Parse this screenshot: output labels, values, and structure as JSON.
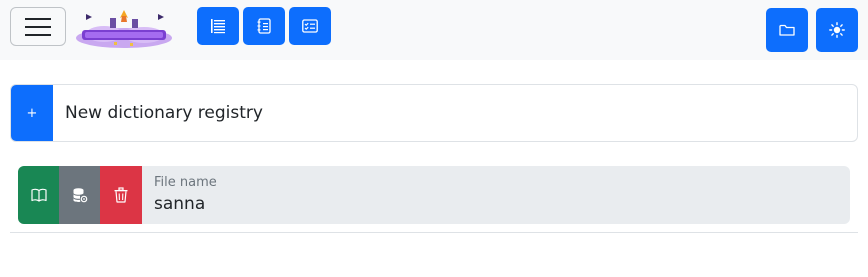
{
  "navbar": {
    "menu_icon": "hamburger-icon",
    "logo_icon": "app-logo",
    "buttons": [
      {
        "icon": "list-icon"
      },
      {
        "icon": "notebook-icon"
      },
      {
        "icon": "checklist-icon"
      },
      {
        "icon": "folder-icon"
      },
      {
        "icon": "sun-icon"
      }
    ]
  },
  "new_entry": {
    "plus_symbol": "+",
    "label": "New dictionary registry"
  },
  "file_row": {
    "field_label": "File name",
    "field_value": "sanna",
    "buttons": [
      {
        "icon": "book-icon",
        "color": "#198754"
      },
      {
        "icon": "database-settings-icon",
        "color": "#6c757d"
      },
      {
        "icon": "trash-icon",
        "color": "#dc3545"
      }
    ]
  },
  "colors": {
    "primary": "#0d6efd",
    "success": "#198754",
    "secondary": "#6c757d",
    "danger": "#dc3545",
    "navbar_bg": "#f8f9fa",
    "field_bg": "#e9ecef"
  }
}
